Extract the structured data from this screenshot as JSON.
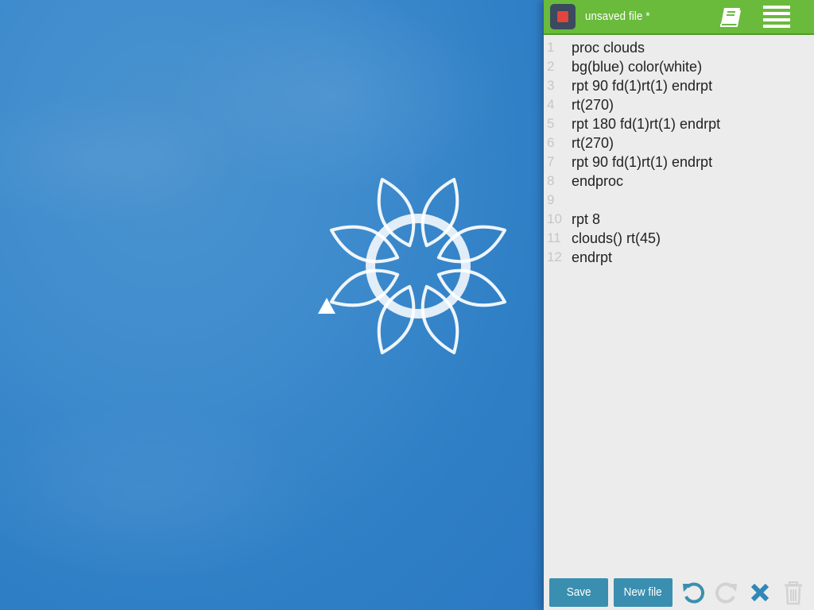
{
  "canvas": {
    "background_color": "#3a88ca",
    "pen_color": "#ffffff"
  },
  "toolbar": {
    "stop_icon": "stop-icon",
    "file_title": "unsaved file *",
    "docs_icon": "book-icon",
    "menu_icon": "menu-icon",
    "accent_color": "#6aba3c"
  },
  "editor": {
    "lines": [
      {
        "num": "1",
        "text": "proc clouds"
      },
      {
        "num": "2",
        "text": "bg(blue) color(white)"
      },
      {
        "num": "3",
        "text": "rpt 90 fd(1)rt(1) endrpt"
      },
      {
        "num": "4",
        "text": "rt(270)"
      },
      {
        "num": "5",
        "text": "rpt 180 fd(1)rt(1) endrpt"
      },
      {
        "num": "6",
        "text": "rt(270)"
      },
      {
        "num": "7",
        "text": "rpt 90 fd(1)rt(1) endrpt"
      },
      {
        "num": "8",
        "text": "endproc"
      },
      {
        "num": "9",
        "text": ""
      },
      {
        "num": "10",
        "text": "rpt 8"
      },
      {
        "num": "11",
        "text": "clouds() rt(45)"
      },
      {
        "num": "12",
        "text": "endrpt"
      }
    ]
  },
  "bottom": {
    "save_label": "Save",
    "new_file_label": "New file",
    "undo_icon": "undo-icon",
    "redo_icon": "redo-icon",
    "close_icon": "close-icon",
    "trash_icon": "trash-icon",
    "button_color": "#3a8fb0"
  }
}
